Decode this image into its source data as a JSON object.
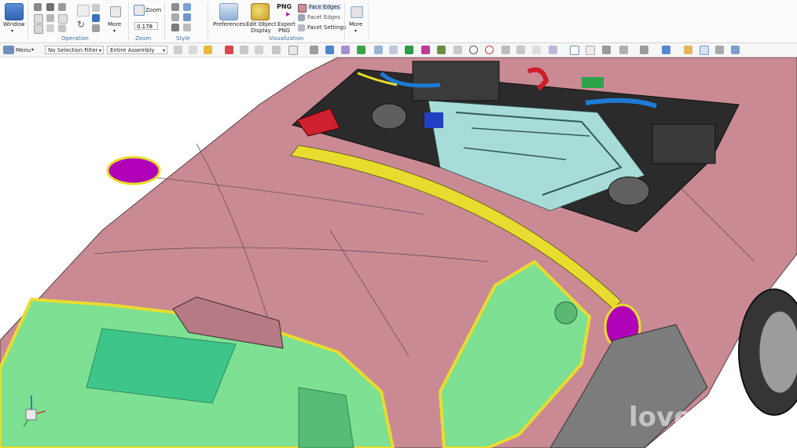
{
  "ribbon": {
    "window_label": "Window",
    "operation_group": "Operation",
    "more_label": "More",
    "zoom_label": "Zoom",
    "zoom_value": "0.178",
    "zoom_group": "Zoom",
    "style_group": "Style",
    "preferences_label": "Preferences",
    "edit_object_display_label1": "Edit Object",
    "edit_object_display_label2": "Display",
    "export_png_label1": "Export",
    "export_png_label2": "PNG",
    "png_badge": "PNG",
    "face_edges_label": "Face Edges",
    "facet_edges_label": "Facet Edges",
    "facet_settings_label": "Facet Settings",
    "visualization_group": "Visualization",
    "more2_label": "More"
  },
  "toolbar": {
    "menu_label": "Menu",
    "selection_filter": "No Selection Filter",
    "assembly_scope": "Entire Assembly"
  },
  "viewport": {
    "watermark": "love"
  },
  "colors": {
    "body": "#c98a94",
    "glass": "#7de092",
    "engine": "#a8dcd8",
    "trim": "#e8dc2e",
    "light": "#b000b8",
    "tire": "#7c7c7c"
  }
}
